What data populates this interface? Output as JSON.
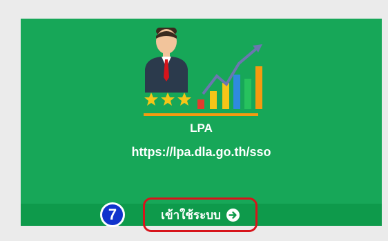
{
  "app": {
    "name": "LPA",
    "url": "https://lpa.dla.go.th/sso",
    "logo_icon": "businessman-rating-growth-icon"
  },
  "login": {
    "label": "เข้าใช้ระบบ",
    "icon": "arrow-right-circle-icon"
  },
  "step": {
    "number": "7"
  },
  "colors": {
    "tile": "#17a758",
    "footer": "#0e9a4b",
    "highlight": "#d7141b",
    "badge": "#1133cc"
  }
}
